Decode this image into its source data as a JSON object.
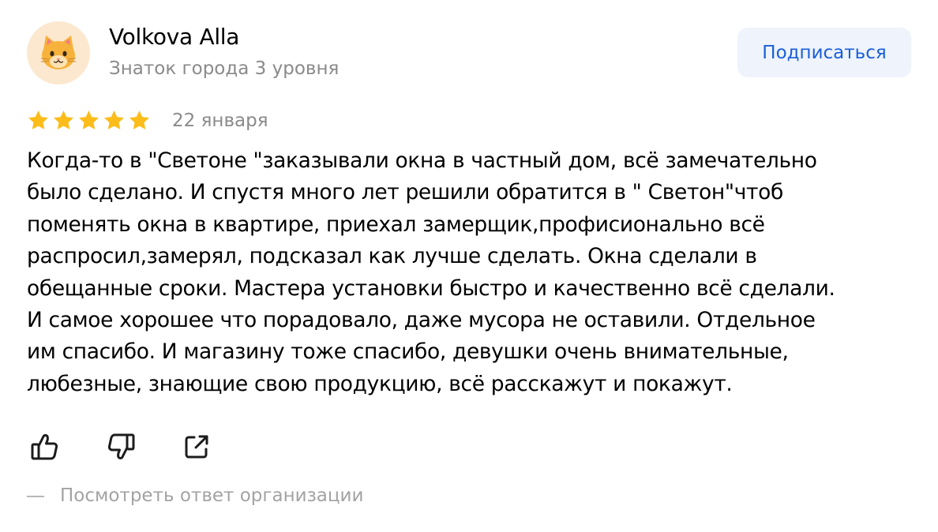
{
  "author": {
    "name": "Volkova Alla",
    "level": "Знаток города 3 уровня",
    "avatar_icon": "cat-face-icon",
    "avatar_bg": "#fbe8cf"
  },
  "subscribe": {
    "label": "Подписаться",
    "color": "#1a5fd8",
    "bg": "#eef3fc"
  },
  "review": {
    "rating": 5,
    "max_rating": 5,
    "star_color": "#fcbc1a",
    "date": "22 января",
    "text_lines": [
      "Когда-то в \"Светоне \"заказывали окна в частный дом, всё замечательно",
      "было сделано. И спустя много лет решили обратится в \" Светон\"чтоб",
      "поменять окна в квартире, приехал замерщик,профисионально всё",
      "распросил,замерял, подсказал как лучше сделать. Окна сделали в",
      "обещанные сроки. Мастера установки быстро и качественно всё сделали.",
      "И самое хорошее что порадовало, даже мусора не оставили. Отдельное",
      "им спасибо. И магазину тоже спасибо, девушки очень внимательные,",
      "любезные, знающие свою продукцию, всё расскажут и покажут."
    ]
  },
  "actions": [
    {
      "name": "like-button",
      "icon": "thumbs-up-icon"
    },
    {
      "name": "dislike-button",
      "icon": "thumbs-down-icon"
    },
    {
      "name": "share-button",
      "icon": "share-icon"
    }
  ],
  "org_reply": {
    "label": "Посмотреть ответ организации"
  }
}
